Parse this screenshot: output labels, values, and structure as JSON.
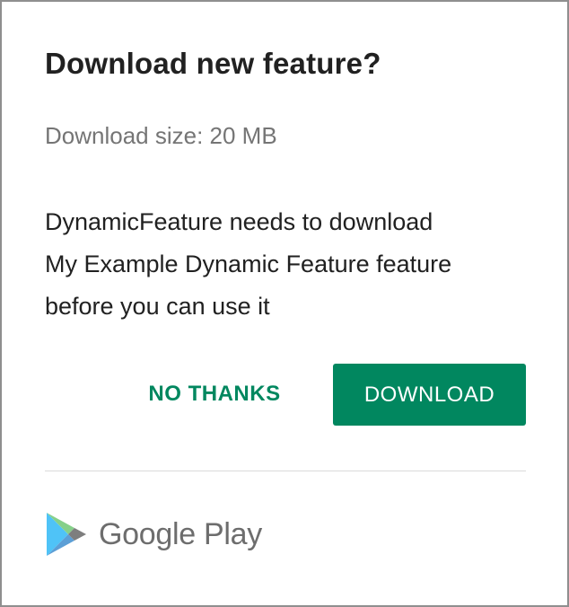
{
  "dialog": {
    "title": "Download new feature?",
    "download_size": "Download size: 20 MB",
    "message_lines": [
      "DynamicFeature needs to download",
      "My Example Dynamic Feature feature",
      "before you can use it"
    ],
    "buttons": {
      "no_thanks": "NO THANKS",
      "download": "DOWNLOAD"
    },
    "footer": {
      "brand_text": "Google Play",
      "icon": "google-play-icon"
    }
  },
  "colors": {
    "accent": "#01875f",
    "title_text": "#212121",
    "secondary_text": "#757575",
    "divider": "#dadada",
    "border": "#8f8f8f"
  }
}
